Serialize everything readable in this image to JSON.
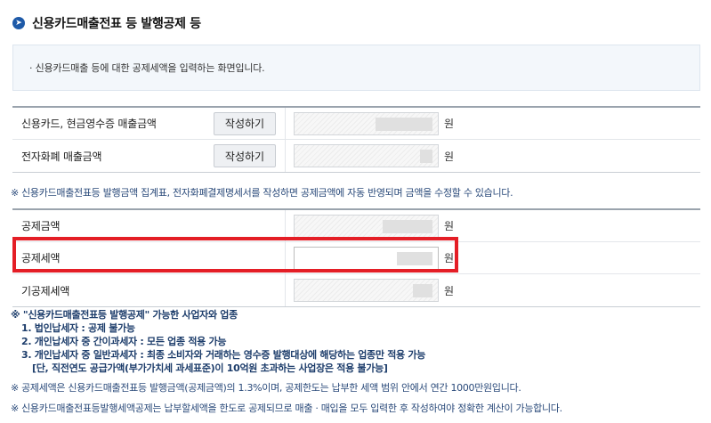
{
  "header": {
    "icon": "arrow-right-circle-icon",
    "title": "신용카드매출전표 등 발행공제 등"
  },
  "info": {
    "text": "· 신용카드매출 등에 대한 공제세액을 입력하는 화면입니다."
  },
  "sales_table": {
    "rows": [
      {
        "label": "신용카드, 현금영수증 매출금액",
        "button": "작성하기",
        "unit": "원",
        "value": ""
      },
      {
        "label": "전자화폐 매출금액",
        "button": "작성하기",
        "unit": "원",
        "value": ""
      }
    ]
  },
  "note1": "※ 신용카드매출전표등 발행금액 집계표, 전자화폐결제명세서를 작성하면 공제금액에 자동 반영되며 금액을 수정할 수 있습니다.",
  "deduct_table": {
    "rows": [
      {
        "label": "공제금액",
        "unit": "원",
        "value": ""
      },
      {
        "label": "공제세액",
        "unit": "원",
        "value": ""
      },
      {
        "label": "기공제세액",
        "unit": "원",
        "value": ""
      }
    ]
  },
  "notes": {
    "title": "※ \"신용카드매출전표등 발행공제\" 가능한 사업자와 업종",
    "items": [
      "1. 법인납세자 : 공제 불가능",
      "2. 개인납세자 중 간이과세자 : 모든 업종 적용 가능",
      "3. 개인납세자 중 일반과세자 : 최종 소비자와 거래하는 영수증 발행대상에 해당하는 업종만 적용 가능"
    ],
    "sub_item": "[단, 직전연도 공급가액(부가가치세 과세표준)이 10억원 초과하는 사업장은 적용 불가능]",
    "limit": "※ 공제세액은 신용카드매출전표등 발행금액(공제금액)의 1.3%이며, 공제한도는 납부한 세액 범위 안에서 연간 1000만원입니다.",
    "last": "※ 신용카드매출전표등발행세액공제는 납부할세액을 한도로 공제되므로 매출 · 매입을 모두 입력한 후 작성하여야 정확한 계산이 가능합니다."
  },
  "colors": {
    "highlight": "#e41e26",
    "accent": "#1e5aa8"
  }
}
